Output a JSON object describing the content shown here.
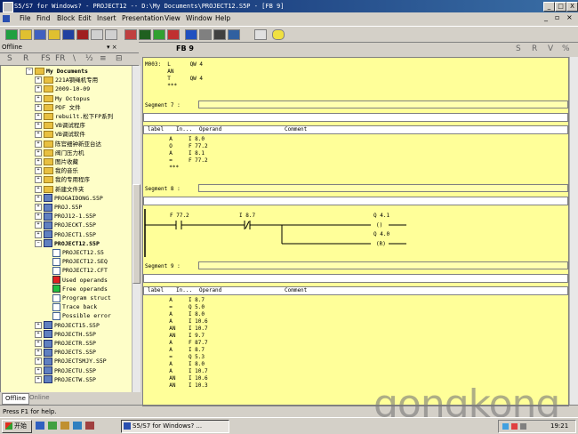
{
  "window": {
    "title": "S5/S7 for Windows? - PROJECT12 -- D:\\My Documents\\PROJECT12.S5P - [FB 9]",
    "minimize": "_",
    "maximize": "□",
    "close": "X"
  },
  "menu": [
    "File",
    "Edit",
    "Find",
    "Block",
    "Edit",
    "Insert",
    "Presentation",
    "View",
    "Window",
    "Help"
  ],
  "left_panel": {
    "header": "Offline",
    "header_controls": "▾ × ",
    "tabs": [
      "S",
      "R",
      "FS",
      "FR",
      "\\",
      "½",
      "≡",
      "⊟"
    ],
    "tree": [
      {
        "label": "My Documents",
        "kind": "folder",
        "bold": true,
        "indent": 0
      },
      {
        "label": "221A钢绳机专用",
        "kind": "folder",
        "indent": 1
      },
      {
        "label": "2009-10-09",
        "kind": "folder",
        "indent": 1
      },
      {
        "label": "My Octopus",
        "kind": "folder",
        "indent": 1
      },
      {
        "label": "PDF 文件",
        "kind": "folder",
        "indent": 1
      },
      {
        "label": "rebuilt.松下FP系列",
        "kind": "folder",
        "indent": 1
      },
      {
        "label": "VB调试程序",
        "kind": "folder",
        "indent": 1
      },
      {
        "label": "VB调试软件",
        "kind": "folder",
        "indent": 1
      },
      {
        "label": "陈官细钟新亚台达",
        "kind": "folder",
        "indent": 1
      },
      {
        "label": "阀门压力机",
        "kind": "folder",
        "indent": 1
      },
      {
        "label": "图片收藏",
        "kind": "folder",
        "indent": 1
      },
      {
        "label": "我的音乐",
        "kind": "folder",
        "indent": 1
      },
      {
        "label": "我的专用程序",
        "kind": "folder",
        "indent": 1
      },
      {
        "label": "新建文件夹",
        "kind": "folder",
        "indent": 1
      },
      {
        "label": "PROGAIDONG.S5P",
        "kind": "proj",
        "indent": 1
      },
      {
        "label": "PROJ.S5P",
        "kind": "proj",
        "indent": 1
      },
      {
        "label": "PROJ12-1.S5P",
        "kind": "proj",
        "indent": 1
      },
      {
        "label": "PROJECKT.S5P",
        "kind": "proj",
        "indent": 1
      },
      {
        "label": "PROJECT1.S5P",
        "kind": "proj",
        "indent": 1
      },
      {
        "label": "PROJECT12.S5P",
        "kind": "proj",
        "bold": true,
        "indent": 1
      },
      {
        "label": "PROJECT12.S5",
        "kind": "doc",
        "indent": 2
      },
      {
        "label": "PROJECT12.SEQ",
        "kind": "doc",
        "indent": 2
      },
      {
        "label": "PROJECT12.CFT",
        "kind": "doc",
        "indent": 2
      },
      {
        "label": "Used operands",
        "kind": "red",
        "indent": 2
      },
      {
        "label": "Free operands",
        "kind": "green",
        "indent": 2
      },
      {
        "label": "Program struct",
        "kind": "doc",
        "indent": 2
      },
      {
        "label": "Trace back",
        "kind": "doc",
        "indent": 2
      },
      {
        "label": "Possible error",
        "kind": "q",
        "indent": 2
      },
      {
        "label": "PROJECT15.S5P",
        "kind": "proj",
        "indent": 1
      },
      {
        "label": "PROJECTH.S5P",
        "kind": "proj",
        "indent": 1
      },
      {
        "label": "PROJECTR.S5P",
        "kind": "proj",
        "indent": 1
      },
      {
        "label": "PROJECTS.S5P",
        "kind": "proj",
        "indent": 1
      },
      {
        "label": "PROJECTSMJY.S5P",
        "kind": "proj",
        "indent": 1
      },
      {
        "label": "PROJECTU.S5P",
        "kind": "proj",
        "indent": 1
      },
      {
        "label": "PROJECTW.S5P",
        "kind": "proj",
        "indent": 1
      }
    ],
    "bottom_tabs": [
      "Offline",
      "Online"
    ]
  },
  "editor": {
    "block_tab": "FB 9",
    "mode_tabs": [
      "S",
      "R",
      "V",
      "%"
    ],
    "top_code": "M003:  L      QW 4\n       AN\n       T      QW 4\n       ***",
    "seg7_label": "Segment 7 :",
    "table_header": {
      "label": "label",
      "instr": "In...",
      "operand": "Operand",
      "comment": "Comment"
    },
    "seg7_code": "       A     I 8.0\n       O     F 77.2\n       A     I 8.1\n       =     F 77.2\n       ***",
    "seg8_label": "Segment 8 :",
    "ladder": {
      "c1": "F 77.2",
      "c2": "I 8.7",
      "o1": "Q 4.1",
      "o1_sym": "()",
      "o2": "Q 4.0",
      "o2_sym": "(R)"
    },
    "seg9_label": "Segment 9 :",
    "seg9_code": "       A     I 8.7\n       =     Q 5.0\n       A     I 8.0\n       A     I 10.6\n       AN    I 10.7\n       AN    I 9.7\n       A     F 87.7\n       A     I 8.7\n       =     Q 5.3\n       A     I 8.0\n       A     I 10.7\n       AN    I 10.6\n       AN    I 10.3"
  },
  "status": {
    "text": "Press F1 for help."
  },
  "taskbar": {
    "start": "开始",
    "task": "S5/S7 for Windows? ...",
    "time": "19:21"
  },
  "watermark": "gongkong"
}
